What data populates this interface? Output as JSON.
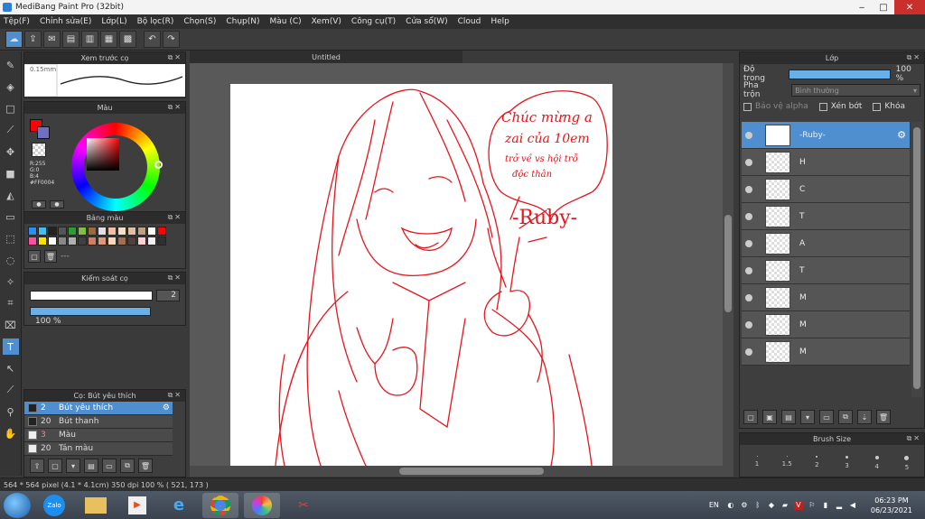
{
  "window": {
    "title": "MediBang Paint Pro (32bit)"
  },
  "menu": [
    "Tệp(F)",
    "Chỉnh sửa(E)",
    "Lớp(L)",
    "Bộ lọc(R)",
    "Chọn(S)",
    "Chụp(N)",
    "Màu (C)",
    "Xem(V)",
    "Công cụ(T)",
    "Cửa sổ(W)",
    "Cloud",
    "Help"
  ],
  "panels": {
    "brush_preview": {
      "title": "Xem trước cọ",
      "size": "0.15mm"
    },
    "color": {
      "title": "Màu",
      "fg_color": "#FF0004",
      "rgb": [
        "R:255",
        "G:0",
        "B:4",
        "#FF0004"
      ]
    },
    "palette": {
      "title": "Bảng màu",
      "footer_text": "---",
      "colors": [
        "#2a8ff0",
        "#3fc0f0",
        "#222222",
        "#555555",
        "#2f9c2f",
        "#80c040",
        "#9c6b3c",
        "#e0e0e0",
        "#f0c0a0",
        "#f8e0c8",
        "#e0c0a0",
        "#c0a080",
        "#ffffff",
        "#ff0004",
        "#ff4fa0",
        "#ffe000",
        "#ffffff",
        "#888888",
        "#b0b0b0",
        "#404040",
        "#d08060",
        "#e09878",
        "#f8d8b8",
        "#a07050",
        "#504040",
        "#ffd0d0",
        "#f0f0f0",
        "#303030"
      ]
    },
    "brush_control": {
      "title": "Kiểm soát cọ",
      "size_value": "2",
      "opacity_value": "100 %"
    },
    "brush_list": {
      "title": "Cọ: Bút yêu thích",
      "items": [
        {
          "num": "2",
          "name": "Bút yêu thích"
        },
        {
          "num": "20",
          "name": "Bút thanh"
        },
        {
          "num": "3",
          "name": "Màu"
        },
        {
          "num": "20",
          "name": "Tán màu"
        }
      ]
    },
    "layers": {
      "title": "Lớp",
      "opacity_label": "Độ trong",
      "opacity_value": "100 %",
      "blend_label": "Pha trộn",
      "blend_value": "Bình thường",
      "protect_alpha": "Bảo vệ alpha",
      "clipping": "Xén bớt",
      "lock": "Khóa",
      "items": [
        "-Ruby-",
        "H",
        "C",
        "T",
        "A",
        "T",
        "M",
        "M",
        "M"
      ]
    },
    "brush_size": {
      "title": "Brush Size",
      "sizes": [
        "1",
        "1.5",
        "2",
        "3",
        "4",
        "5"
      ]
    }
  },
  "document": {
    "tab": "Untitled"
  },
  "artwork": {
    "bubble_lines": [
      "Chúc mừng a",
      "zai của 10em",
      "trở về vs hội trỗ",
      "độc thân"
    ],
    "signature": "-Ruby-"
  },
  "status": {
    "text": "564 * 564 pixel  (4.1 * 4.1cm)  350 dpi  100 %  ( 521, 173 )"
  },
  "taskbar": {
    "zalo": "Zalo",
    "lang": "EN",
    "time": "06:23 PM",
    "date": "06/23/2021"
  }
}
